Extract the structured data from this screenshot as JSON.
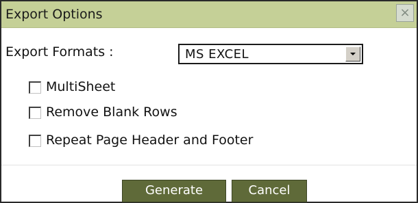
{
  "dialog": {
    "title": "Export Options",
    "close_icon": "×"
  },
  "export_formats": {
    "label": "Export Formats :",
    "selected": "MS EXCEL"
  },
  "options": [
    {
      "label": "MultiSheet",
      "checked": false
    },
    {
      "label": "Remove Blank Rows",
      "checked": false
    },
    {
      "label": "Repeat Page Header and Footer",
      "checked": false
    }
  ],
  "buttons": {
    "generate": "Generate",
    "cancel": "Cancel"
  },
  "colors": {
    "titlebar": "#c5d097",
    "button": "#5f6a39"
  }
}
